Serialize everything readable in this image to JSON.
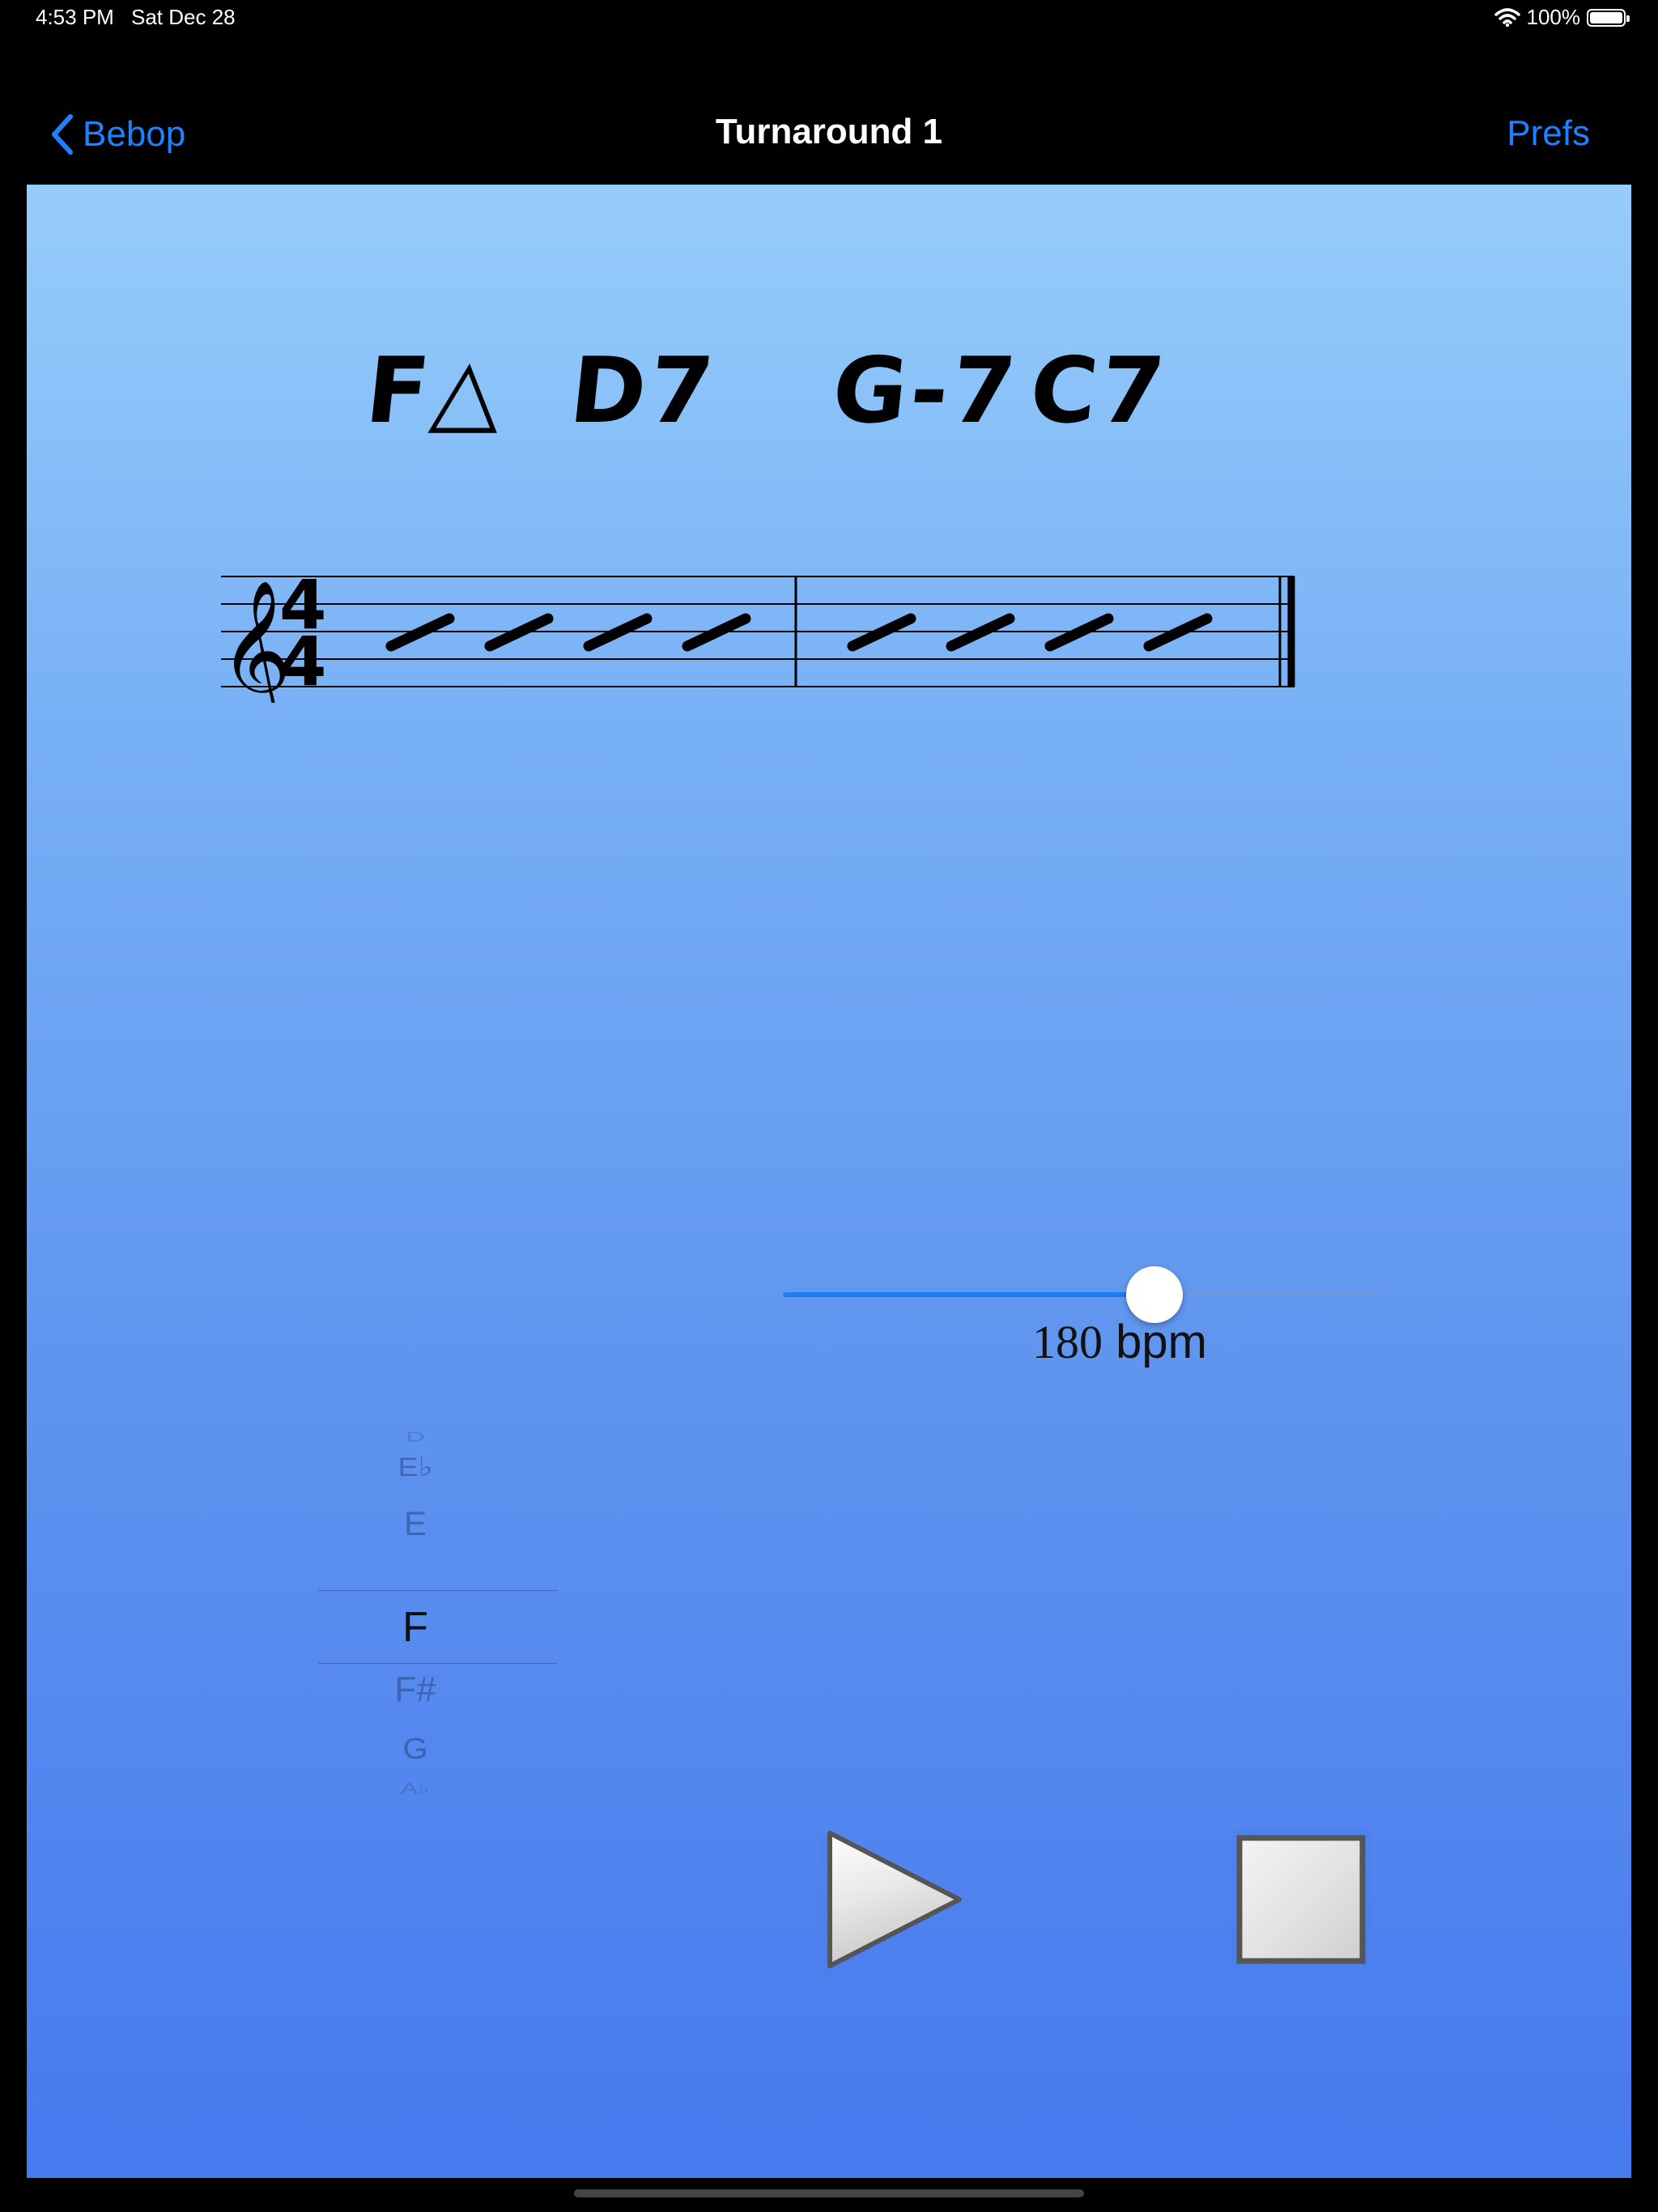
{
  "status_bar": {
    "time": "4:53 PM",
    "date": "Sat Dec 28",
    "battery": "100%"
  },
  "nav": {
    "back_label": "Bebop",
    "title": "Turnaround 1",
    "prefs_label": "Prefs"
  },
  "chart": {
    "chords": [
      "F△",
      "D7",
      "G-7",
      "C7"
    ],
    "time_signature": {
      "top": "4",
      "bottom": "4"
    },
    "measures": 2,
    "beats_per_measure": 4
  },
  "tempo": {
    "bpm_value": "180",
    "bpm_unit": "bpm",
    "slider_fraction": 0.62
  },
  "key_picker": {
    "items": [
      "D",
      "E♭",
      "E",
      "F",
      "F#",
      "G",
      "A♭"
    ],
    "selected": "F"
  },
  "controls": {
    "play_icon": "play-icon",
    "stop_icon": "stop-icon"
  }
}
